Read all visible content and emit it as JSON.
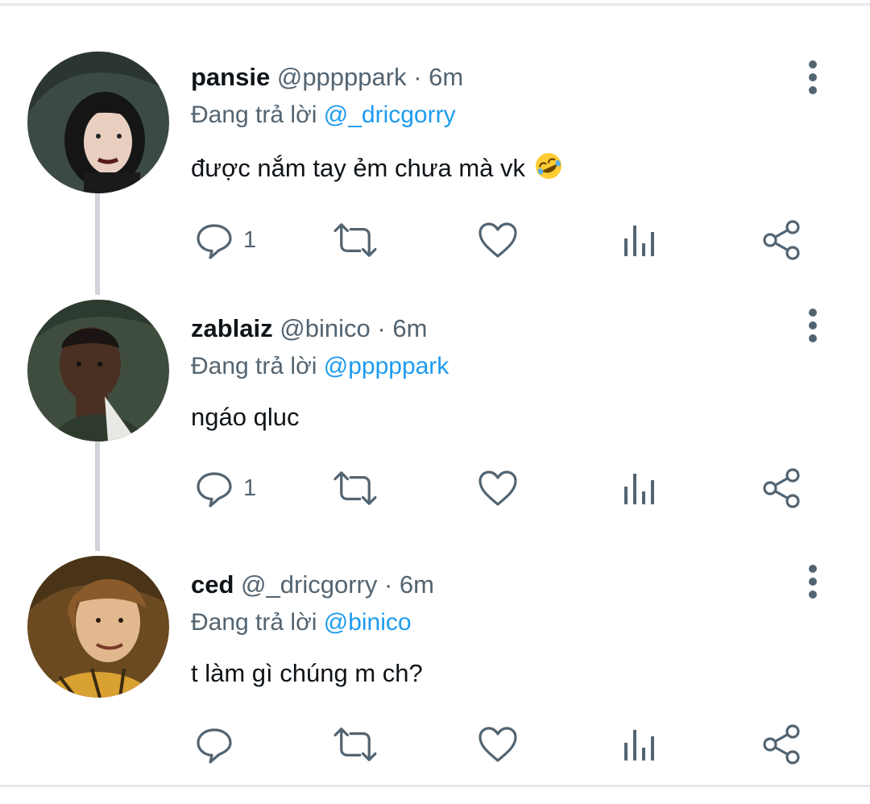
{
  "tweets": [
    {
      "name": "pansie",
      "handle": "@pppppark",
      "sep": "·",
      "time": "6m",
      "reply_prefix": "Đang trả lời",
      "reply_to": "@_dricgorry",
      "text": "được nắm tay ẻm chưa mà vk",
      "emoji": "rolling-on-floor-laughing",
      "reply_count": "1",
      "avatar_colors": {
        "bg": "#3b4a45",
        "hair": "#151515",
        "skin": "#e8cfc0"
      }
    },
    {
      "name": "zablaiz",
      "handle": "@binico",
      "sep": "·",
      "time": "6m",
      "reply_prefix": "Đang trả lời",
      "reply_to": "@pppppark",
      "text": "ngáo qluc",
      "reply_count": "1",
      "avatar_colors": {
        "bg": "#3f4d3e",
        "hair": "#1a1512",
        "skin": "#4a3022"
      }
    },
    {
      "name": "ced",
      "handle": "@_dricgorry",
      "sep": "·",
      "time": "6m",
      "reply_prefix": "Đang trả lời",
      "reply_to": "@binico",
      "text": "t làm gì chúng m ch?",
      "reply_count": "",
      "avatar_colors": {
        "bg": "#6b4a22",
        "hair": "#8a5a2a",
        "skin": "#e2b98f"
      }
    }
  ],
  "icons": [
    "reply-icon",
    "retweet-icon",
    "like-icon",
    "views-icon",
    "share-icon",
    "more-icon"
  ],
  "colors": {
    "icon": "#536471",
    "mention": "#1d9bf0",
    "text": "#0f1419",
    "thread_line": "#d0d4d8"
  }
}
